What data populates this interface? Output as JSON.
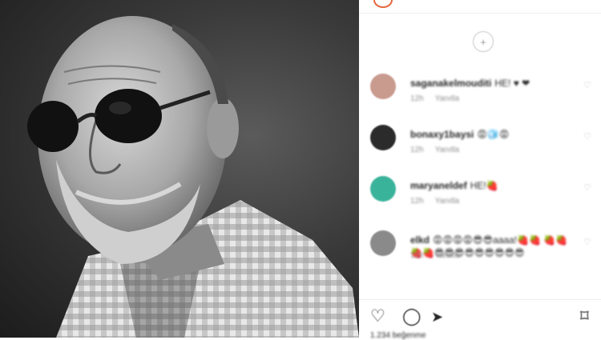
{
  "photo": {
    "alt": ""
  },
  "load_more": {
    "icon": "plus-circle-icon",
    "symbol": "+"
  },
  "comments": [
    {
      "username": "saganakelmouditi",
      "text": "HE! ♥ ❤",
      "time": "12h",
      "reply": "Yanıtla",
      "avatar_color": "#c99a8e"
    },
    {
      "username": "bonaxy1baysi",
      "text": "😡🧊😡",
      "time": "12h",
      "reply": "Yanıtla",
      "avatar_color": "#2b2b2b"
    },
    {
      "username": "maryaneldef",
      "text": "HE!🍓",
      "time": "12h",
      "reply": "Yanıtla",
      "avatar_color": "#3ab39b"
    },
    {
      "username": "elkd",
      "text": "😡😡😡😡😎😎aaaa!🍓🍓 🍓🍓🍓🍓😎😎😎😎😎😎😎😎😎",
      "time": "12h",
      "reply": "Yanıtla",
      "avatar_color": "#8a8a8a"
    }
  ],
  "actions": {
    "like": "♡",
    "comment": "◯",
    "share": "➤",
    "save": "⌑"
  },
  "likes_text": "1.234 beğenme"
}
